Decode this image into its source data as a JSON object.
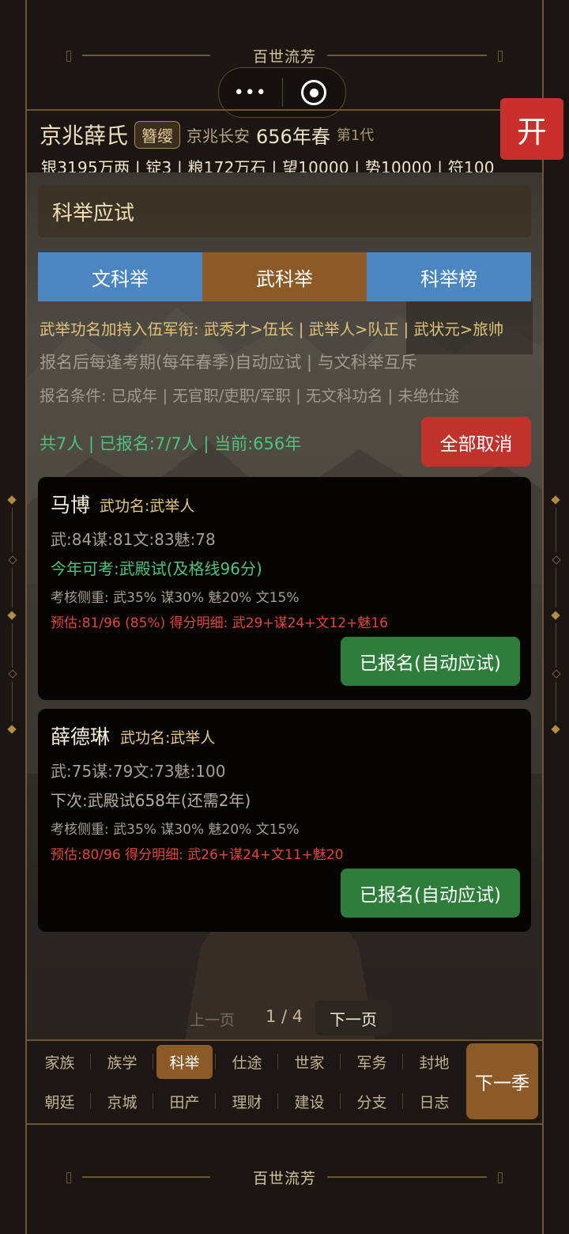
{
  "app": {
    "title": "百世流芳"
  },
  "capsule": {
    "more_glyph": "•••"
  },
  "header": {
    "family_name": "京兆薛氏",
    "rank_badge": "簪缨",
    "location": "京兆长安",
    "year": "656年春",
    "generation": "第1代",
    "resources": "银3195万两 | 锭3 | 粮172万石 | 望10000 | 势10000 | 符100"
  },
  "open_button": {
    "label": "开",
    "color": "#c9302c"
  },
  "panel": {
    "title": "科举应试",
    "tabs": [
      {
        "label": "文科举",
        "active": false
      },
      {
        "label": "武科举",
        "active": true
      },
      {
        "label": "科举榜",
        "active": false
      }
    ],
    "rules": [
      "武举功名加持入伍军衔: 武秀才>伍长 | 武举人>队正 | 武状元>旅帅",
      "报名后每逢考期(每年春季)自动应试 | 与文科举互斥",
      "报名条件: 已成年 | 无官职/吏职/军职 | 无文科功名 | 未绝仕途"
    ],
    "summary": "共7人 | 已报名:7/7人 | 当前:656年",
    "cancel_all_label": "全部取消"
  },
  "candidates": [
    {
      "name": "马博",
      "merit": "武功名:武举人",
      "stats": "武:84谋:81文:83魅:78",
      "exam": "今年可考:武殿试(及格线96分)",
      "exam_color": "#52c27a",
      "weights": "考核侧重: 武35% 谋30% 魅20% 文15%",
      "estimate": "预估:81/96 (85%)  得分明细: 武29+谋24+文12+魅16",
      "status_label": "已报名(自动应试)"
    },
    {
      "name": "薛德琳",
      "merit": "武功名:武举人",
      "stats": "武:75谋:79文:73魅:100",
      "exam": "下次:武殿试658年(还需2年)",
      "exam_color": "#b6ad9e",
      "weights": "考核侧重: 武35% 谋30% 魅20% 文15%",
      "estimate": "预估:80/96  得分明细: 武26+谋24+文11+魅20",
      "status_label": "已报名(自动应试)"
    }
  ],
  "pager": {
    "prev_label": "上一页",
    "page": "1 / 4",
    "next_label": "下一页"
  },
  "bottom_nav": {
    "row1": [
      {
        "label": "家族",
        "active": false
      },
      {
        "label": "族学",
        "active": false
      },
      {
        "label": "科举",
        "active": true
      },
      {
        "label": "仕途",
        "active": false
      },
      {
        "label": "世家",
        "active": false
      },
      {
        "label": "军务",
        "active": false
      },
      {
        "label": "封地",
        "active": false
      }
    ],
    "row2": [
      {
        "label": "朝廷",
        "active": false
      },
      {
        "label": "京城",
        "active": false
      },
      {
        "label": "田产",
        "active": false
      },
      {
        "label": "理财",
        "active": false
      },
      {
        "label": "建设",
        "active": false
      },
      {
        "label": "分支",
        "active": false
      },
      {
        "label": "日志",
        "active": false
      }
    ],
    "next_season_label": "下一季"
  },
  "footer": {
    "title": "百世流芳"
  }
}
